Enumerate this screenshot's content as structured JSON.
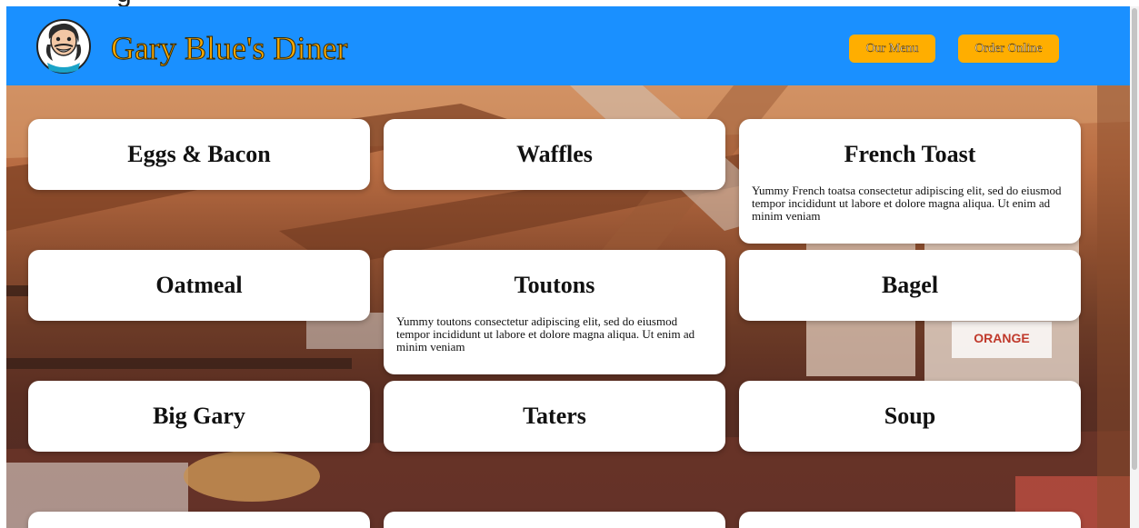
{
  "header": {
    "brand": "Gary Blue's Diner",
    "nav": [
      {
        "label": "Our Menu"
      },
      {
        "label": "Order Online"
      }
    ]
  },
  "menu": [
    {
      "title": "Eggs & Bacon",
      "description": ""
    },
    {
      "title": "Waffles",
      "description": ""
    },
    {
      "title": "French Toast",
      "description": "Yummy French toatsa consectetur adipiscing elit, sed do eiusmod tempor incididunt ut labore et dolore magna aliqua. Ut enim ad minim veniam"
    },
    {
      "title": "Oatmeal",
      "description": ""
    },
    {
      "title": "Toutons",
      "description": "Yummy toutons consectetur adipiscing elit, sed do eiusmod tempor incididunt ut labore et dolore magna aliqua. Ut enim ad minim veniam"
    },
    {
      "title": "Bagel",
      "description": ""
    },
    {
      "title": "Big Gary",
      "description": ""
    },
    {
      "title": "Taters",
      "description": ""
    },
    {
      "title": "Soup",
      "description": ""
    }
  ],
  "colors": {
    "header_bg": "#1a90ff",
    "brand_text": "#f5a800",
    "button_bg": "#ffae00",
    "card_bg": "#ffffff"
  },
  "icons": {
    "logo": "chef-caricature-logo"
  }
}
